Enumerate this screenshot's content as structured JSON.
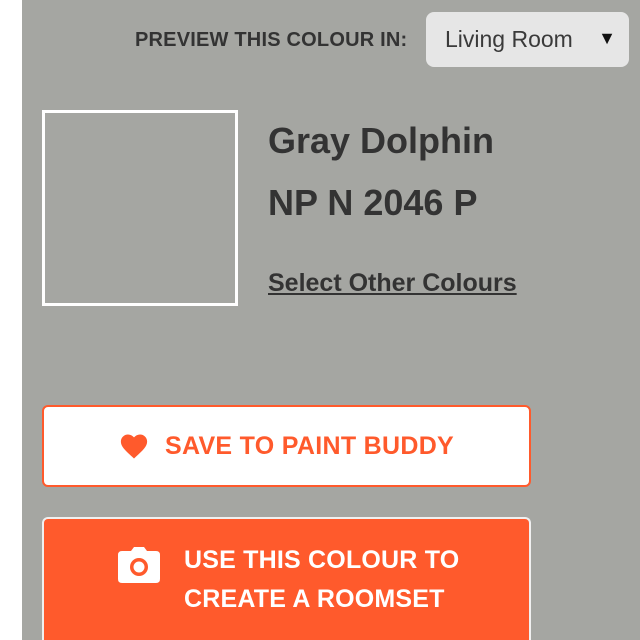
{
  "preview": {
    "label": "PREVIEW THIS COLOUR IN:",
    "room_selected": "Living Room",
    "dropdown_arrow": "▼"
  },
  "colour": {
    "name": "Gray Dolphin",
    "code": "NP N 2046 P",
    "swatch_hex": "#a5a6a2",
    "select_other_label": "Select Other Colours"
  },
  "actions": {
    "save_label": "SAVE TO PAINT BUDDY",
    "save_icon": "heart-icon",
    "roomset_line1": "USE THIS COLOUR TO",
    "roomset_line2": "CREATE A ROOMSET",
    "roomset_icon": "camera-icon",
    "accent": "#ff5a2c"
  }
}
